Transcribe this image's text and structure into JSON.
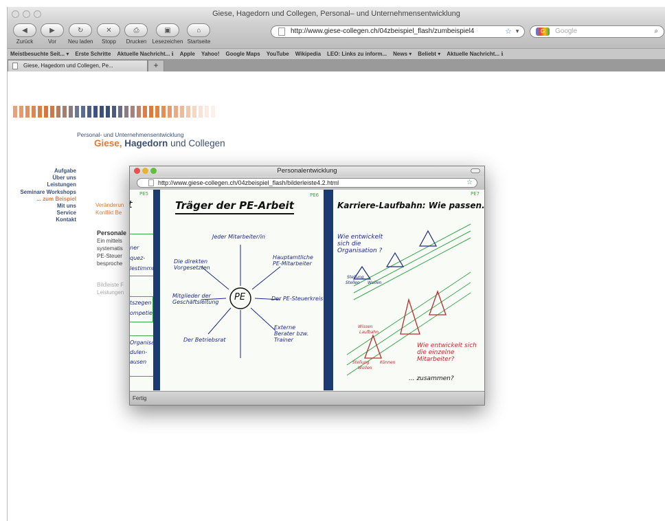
{
  "window": {
    "title": "Giese, Hagedorn und Collegen, Personal– und Unternehmensentwicklung"
  },
  "toolbar": {
    "back": "Zurück",
    "forward": "Vor",
    "reload": "Neu laden",
    "stop": "Stopp",
    "print": "Drucken",
    "bookmarks": "Lesezeichen",
    "home": "Startseite",
    "url": "http://www.giese-collegen.ch/04zbeispiel_flash/zumbeispiel4",
    "search_placeholder": "Google"
  },
  "bookmarks_bar": [
    "Meistbesuchte Seit... ▾",
    "Erste Schritte",
    "Aktuelle Nachricht... ℹ",
    "Apple",
    "Yahoo!",
    "Google Maps",
    "YouTube",
    "Wikipedia",
    "LEO: Links zu inform...",
    "News ▾",
    "Beliebt ▾",
    "Aktuelle Nachricht... ℹ"
  ],
  "tab": {
    "label": "Giese, Hagedorn und Collegen, Pe...",
    "new_tab": "+"
  },
  "site": {
    "subtitle": "Personal- und Unternehmensentwicklung",
    "brand_giese": "Giese,",
    "brand_hagedorn": "Hagedorn",
    "brand_und": "und Collegen",
    "nav": [
      "Aufgabe",
      "Über uns",
      "Leistungen",
      "Seminare Workshops",
      "... zum Beispiel",
      "Mit uns",
      "Service",
      "Kontakt"
    ],
    "orange_1": "Veränderun",
    "orange_2": "Konflikt Be",
    "heading": "Personale",
    "body_1": "Ein mittels",
    "body_2": "systematis",
    "body_3": "PE-Steuer",
    "body_4": "besproche",
    "grey_1": "Bildleiste F",
    "grey_2": "Leistungen"
  },
  "popup": {
    "title": "Personalentwicklung",
    "url": "http://www.giese-collegen.ch/04zbeispiel_flash/bilderleiste4.2.html",
    "status": "Fertig",
    "slide_left": {
      "tag": "PE5",
      "frag_1": "t",
      "frag_2": "ner",
      "frag_3": "quez-",
      "frag_4": "lestimmungs-",
      "frag_5": "tszegen",
      "frag_6": "ompetie",
      "frag_7": "Organisation",
      "frag_8": "dulen-",
      "frag_9": "ausen"
    },
    "slide_middle": {
      "tag": "PE6",
      "title": "Träger der PE-Arbeit",
      "center": "PE",
      "items": [
        "Jeder Mitarbeiter/in",
        "Die direkten Vorgesetzten",
        "Hauptamtliche PE-Mitarbeiter",
        "Mitglieder der Geschäftsleitung",
        "Der PE-Steuerkreis",
        "Der Betriebsrat",
        "Externe Berater bzw. Trainer"
      ]
    },
    "slide_right": {
      "tag": "PE7",
      "title": "Karriere-Laufbahn: Wie passen...",
      "q1": "Wie entwickelt sich die Organisation ?",
      "labels": [
        "Stellung",
        "Stellen",
        "Wollen",
        "Wissen",
        "Laufbahn",
        "Stellung",
        "Wollen",
        "Können"
      ],
      "q2": "Wie entwickelt sich die einzelne Mitarbeiter?",
      "end": "... zusammen?"
    }
  }
}
